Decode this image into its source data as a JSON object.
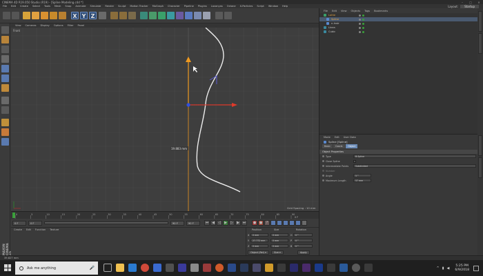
{
  "window": {
    "title": "CINEMA 4D R19.050 Studio (R19) - [Spline Modeling.c4d *]",
    "controls": [
      "–",
      "□",
      "✕"
    ]
  },
  "menubar": {
    "items": [
      "File",
      "Edit",
      "Create",
      "Select",
      "Tools",
      "Mesh",
      "Snap",
      "Animate",
      "Simulate",
      "Render",
      "Sculpt",
      "Motion Tracker",
      "MoGraph",
      "Character",
      "Pipeline",
      "Plugins",
      "Lavanyas",
      "Octane",
      "X-Particles",
      "Script",
      "Window",
      "Help"
    ],
    "layout_label": "Layout:",
    "layout_value": "Startup"
  },
  "toolbar": {
    "axis_letters": [
      "X",
      "Y",
      "Z"
    ]
  },
  "viewport": {
    "menu": [
      "View",
      "Cameras",
      "Display",
      "Options",
      "Filter",
      "Panel"
    ],
    "camera_label": "Front",
    "measure_label": "19.883 mm",
    "grid_spacing": "Grid Spacing : 10 mm"
  },
  "timeline": {
    "ticks": [
      "0",
      "5",
      "10",
      "15",
      "20",
      "25",
      "30",
      "35",
      "40",
      "45",
      "50",
      "55",
      "60",
      "65",
      "70",
      "75",
      "80",
      "85",
      "90"
    ],
    "frame_end_tag": "0 F"
  },
  "playbar": {
    "start_field": "0 F",
    "current_field": "0 F",
    "end_field": "90 F",
    "max_field": "90 F"
  },
  "materials": {
    "menu": [
      "Create",
      "Edit",
      "Function",
      "Texture"
    ]
  },
  "coordinates": {
    "headers": [
      "Position",
      "Size",
      "Rotation"
    ],
    "rows": [
      {
        "axis": "X",
        "pos": "0 mm",
        "size": "0 mm",
        "rot_label": "H",
        "rot": "0 °"
      },
      {
        "axis": "Y",
        "pos": "27.772 mm",
        "size": "0 mm",
        "rot_label": "P",
        "rot": "0 °"
      },
      {
        "axis": "Z",
        "pos": "0 mm",
        "size": "0 mm",
        "rot_label": "B",
        "rot": "0 °"
      }
    ],
    "mode": "Object (Rel) ▾",
    "size_mode": "Size ▾",
    "apply": "Apply"
  },
  "object_manager": {
    "menu": [
      "File",
      "Edit",
      "View",
      "Objects",
      "Tags",
      "Bookmarks"
    ],
    "objects": [
      {
        "name": "Lathe",
        "selected": false
      },
      {
        "name": "Spline",
        "selected": true
      },
      {
        "name": "n-Instr",
        "selected": false
      },
      {
        "name": "Linea",
        "selected": false
      },
      {
        "name": "Cubic",
        "selected": false
      }
    ]
  },
  "attributes": {
    "menu": [
      "Mode",
      "Edit",
      "User Data"
    ],
    "object_title": "Spline [Spline]",
    "tabs": [
      "Basic",
      "Coord.",
      "Object"
    ],
    "active_tab": "Object",
    "section": "Object Properties",
    "fields": [
      {
        "label": "Type",
        "value": "B-Spline"
      },
      {
        "label": "Close Spline",
        "value": ""
      },
      {
        "label": "Intermediate Points",
        "value": "Subdivided"
      },
      {
        "label": "Number",
        "value": ""
      },
      {
        "label": "Angle",
        "value": "5 °"
      },
      {
        "label": "Maximum Length",
        "value": "57 mm"
      }
    ]
  },
  "sidebar_vertical_label": "MAXON CINEMA 4D",
  "statusbar": {
    "text": "39.827 mm"
  },
  "taskbar": {
    "search_placeholder": "Ask me anything",
    "time": "5:25 PM",
    "date": "6/9/2018"
  },
  "colors": {
    "accent": "#6a8ab5",
    "axis_x": "#e03a2a",
    "axis_y": "#f09a20",
    "axis_z": "#3050e0"
  }
}
